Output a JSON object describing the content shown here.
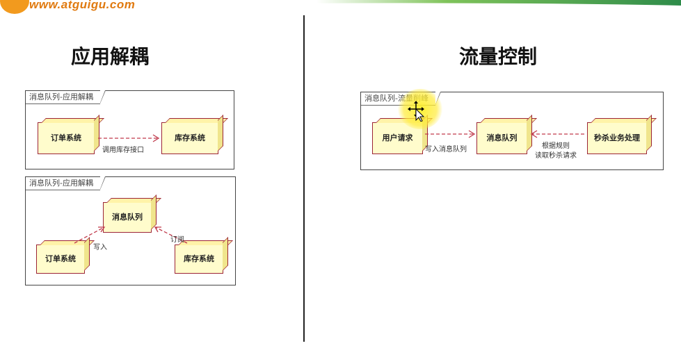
{
  "banner": {
    "logo_text": "www.atguigu.com"
  },
  "left": {
    "title": "应用解耦",
    "diagram1": {
      "frame_label": "消息队列-应用解耦",
      "node_a": "订单系统",
      "node_b": "库存系统",
      "edge": "调用库存接口"
    },
    "diagram2": {
      "frame_label": "消息队列-应用解耦",
      "node_queue": "消息队列",
      "node_order": "订单系统",
      "node_stock": "库存系统",
      "edge_write": "写入",
      "edge_sub": "订阅"
    }
  },
  "right": {
    "title": "流量控制",
    "diagram": {
      "frame_label": "消息队列-流量削峰",
      "node_user": "用户请求",
      "node_queue": "消息队列",
      "node_seckill": "秒杀业务处理",
      "edge_write": "写入消息队列",
      "edge_read_1": "根据规则",
      "edge_read_2": "读取秒杀请求"
    }
  },
  "colors": {
    "node_fill": "#fffccc",
    "node_border": "#9b2335",
    "arrow": "#c0394b",
    "highlight": "#fff028"
  },
  "icons": {
    "cursor": "move-cursor-icon"
  }
}
